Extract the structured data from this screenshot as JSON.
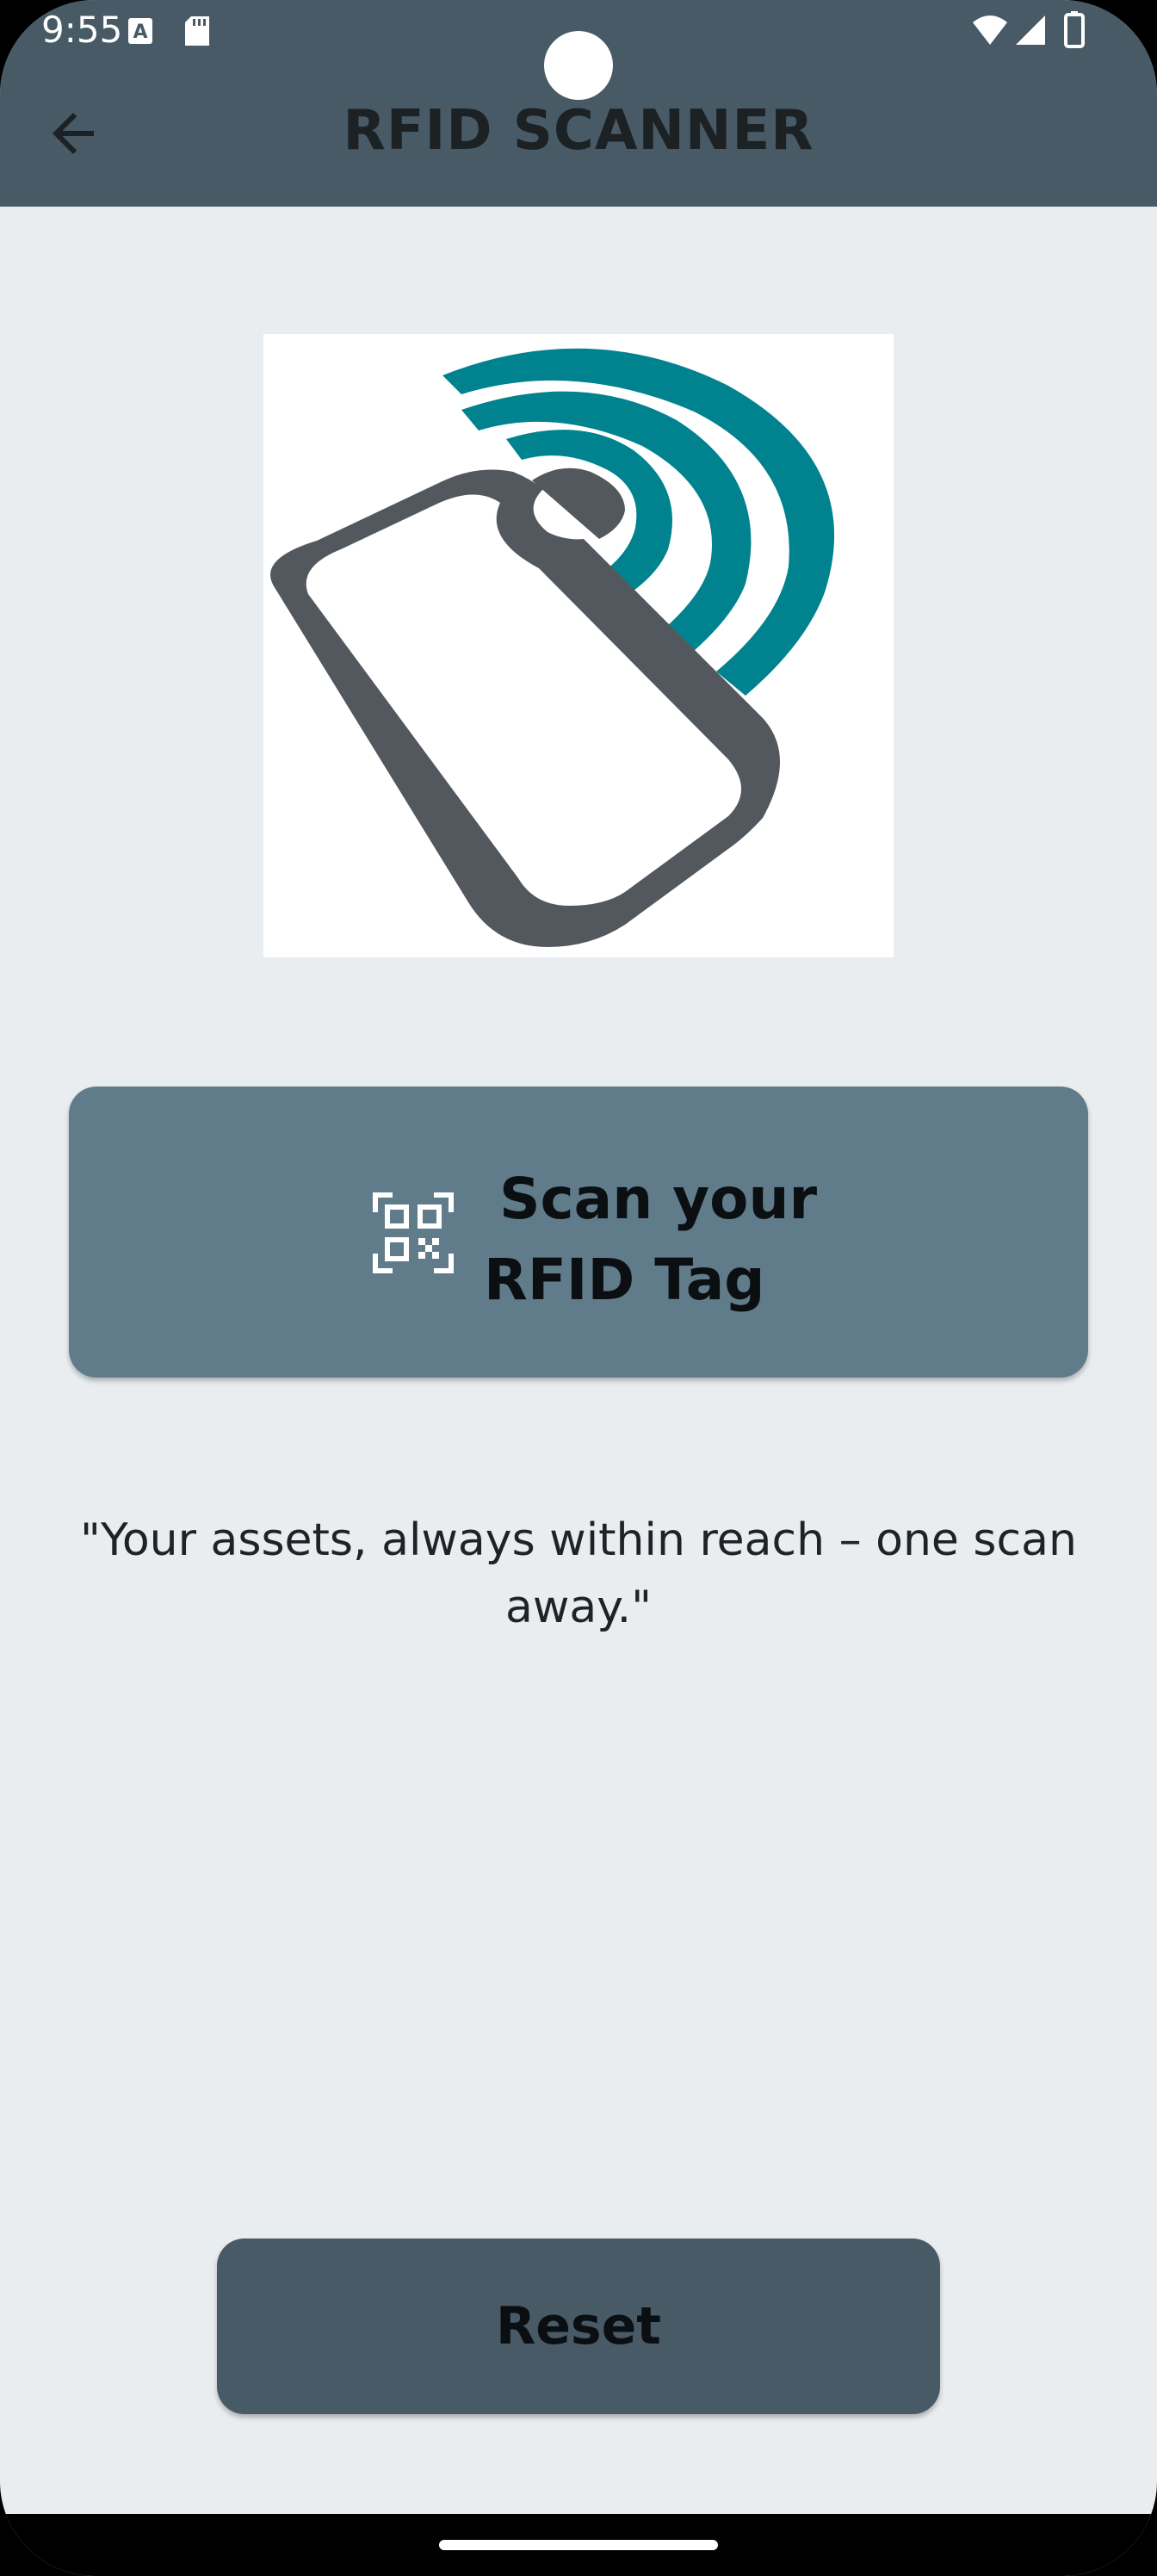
{
  "status_bar": {
    "time": "9:55",
    "icons": [
      "keyboard-icon",
      "sd-card-icon",
      "wifi-icon",
      "signal-icon",
      "battery-icon"
    ]
  },
  "app_bar": {
    "title": "RFID SCANNER",
    "back_icon": "arrow-back-icon",
    "color": "#475a66"
  },
  "hero": {
    "icon": "rfid-tag-icon",
    "colors": {
      "tag": "#53585e",
      "waves": "#00838f"
    }
  },
  "scan_button": {
    "line1": "Scan your",
    "line2": "RFID Tag",
    "icon": "qr-scan-icon",
    "color": "#607c8a"
  },
  "tagline": "\"Your assets, always within reach – one scan away.\"",
  "reset_button": {
    "label": "Reset",
    "color": "#475a66"
  },
  "theme": {
    "background": "#e9edf0"
  }
}
